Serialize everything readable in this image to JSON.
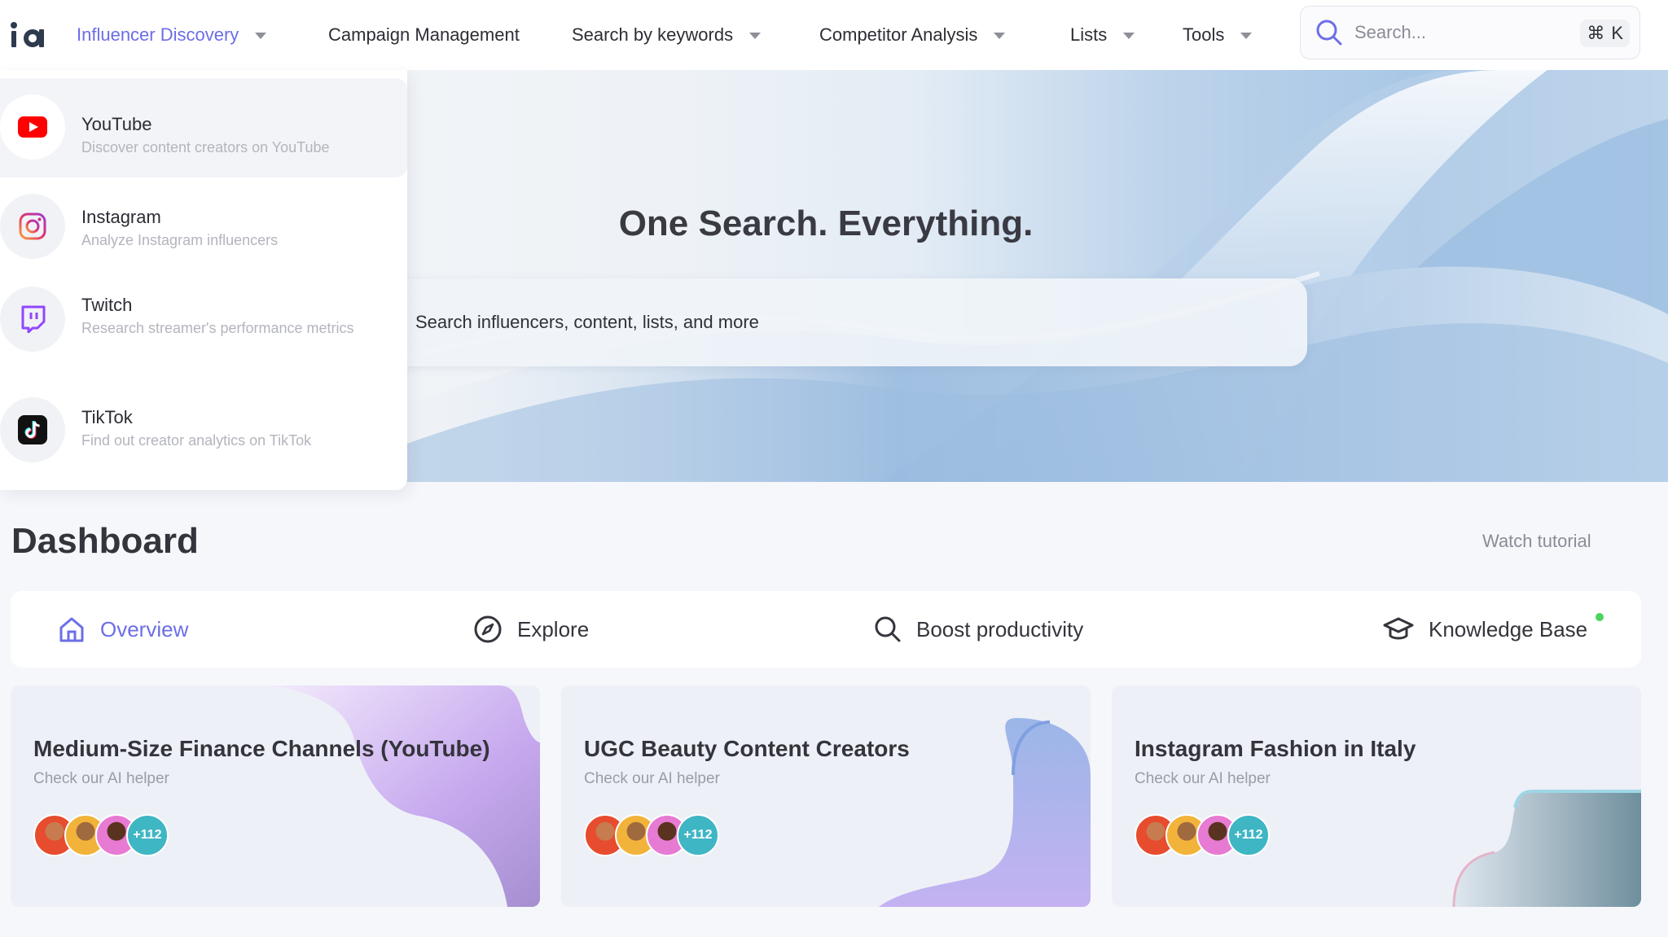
{
  "nav": {
    "items": [
      {
        "label": "Influencer Discovery",
        "has_caret": true,
        "active": true
      },
      {
        "label": "Campaign Management",
        "has_caret": false,
        "active": false
      },
      {
        "label": "Search by keywords",
        "has_caret": true,
        "active": false
      },
      {
        "label": "Competitor Analysis",
        "has_caret": true,
        "active": false
      },
      {
        "label": "Lists",
        "has_caret": true,
        "active": false
      },
      {
        "label": "Tools",
        "has_caret": true,
        "active": false
      }
    ],
    "search_placeholder": "Search...",
    "shortcut_symbol": "⌘",
    "shortcut_key": "K"
  },
  "dropdown": {
    "items": [
      {
        "title": "YouTube",
        "description": "Discover content creators on YouTube",
        "icon": "youtube-icon",
        "highlighted": true
      },
      {
        "title": "Instagram",
        "description": "Analyze Instagram influencers",
        "icon": "instagram-icon",
        "highlighted": false
      },
      {
        "title": "Twitch",
        "description": "Research streamer's performance metrics",
        "icon": "twitch-icon",
        "highlighted": false
      },
      {
        "title": "TikTok",
        "description": "Find out creator analytics on TikTok",
        "icon": "tiktok-icon",
        "highlighted": false
      }
    ]
  },
  "hero": {
    "title": "One Search. Everything.",
    "search_placeholder": "Search influencers, content, lists, and more"
  },
  "dashboard": {
    "title": "Dashboard",
    "watch_tutorial": "Watch tutorial",
    "tabs": [
      {
        "label": "Overview",
        "icon": "home-icon",
        "active": true
      },
      {
        "label": "Explore",
        "icon": "compass-icon",
        "active": false
      },
      {
        "label": "Boost productivity",
        "icon": "search-icon",
        "active": false
      },
      {
        "label": "Knowledge Base",
        "icon": "graduation-cap-icon",
        "active": false,
        "has_dot": true
      }
    ],
    "cards": [
      {
        "title": "Medium-Size Finance Channels (YouTube)",
        "subtitle": "Check our AI helper",
        "more_count": "+112"
      },
      {
        "title": "UGC Beauty Content Creators",
        "subtitle": "Check our AI helper",
        "more_count": "+112"
      },
      {
        "title": "Instagram Fashion in Italy",
        "subtitle": "Check our AI helper",
        "more_count": "+112"
      }
    ]
  },
  "colors": {
    "accent": "#6c6ee6",
    "youtube": "#ff0000",
    "twitch": "#9146ff",
    "status_dot": "#4cd35c",
    "avatar_more": "#3fb6c4"
  }
}
